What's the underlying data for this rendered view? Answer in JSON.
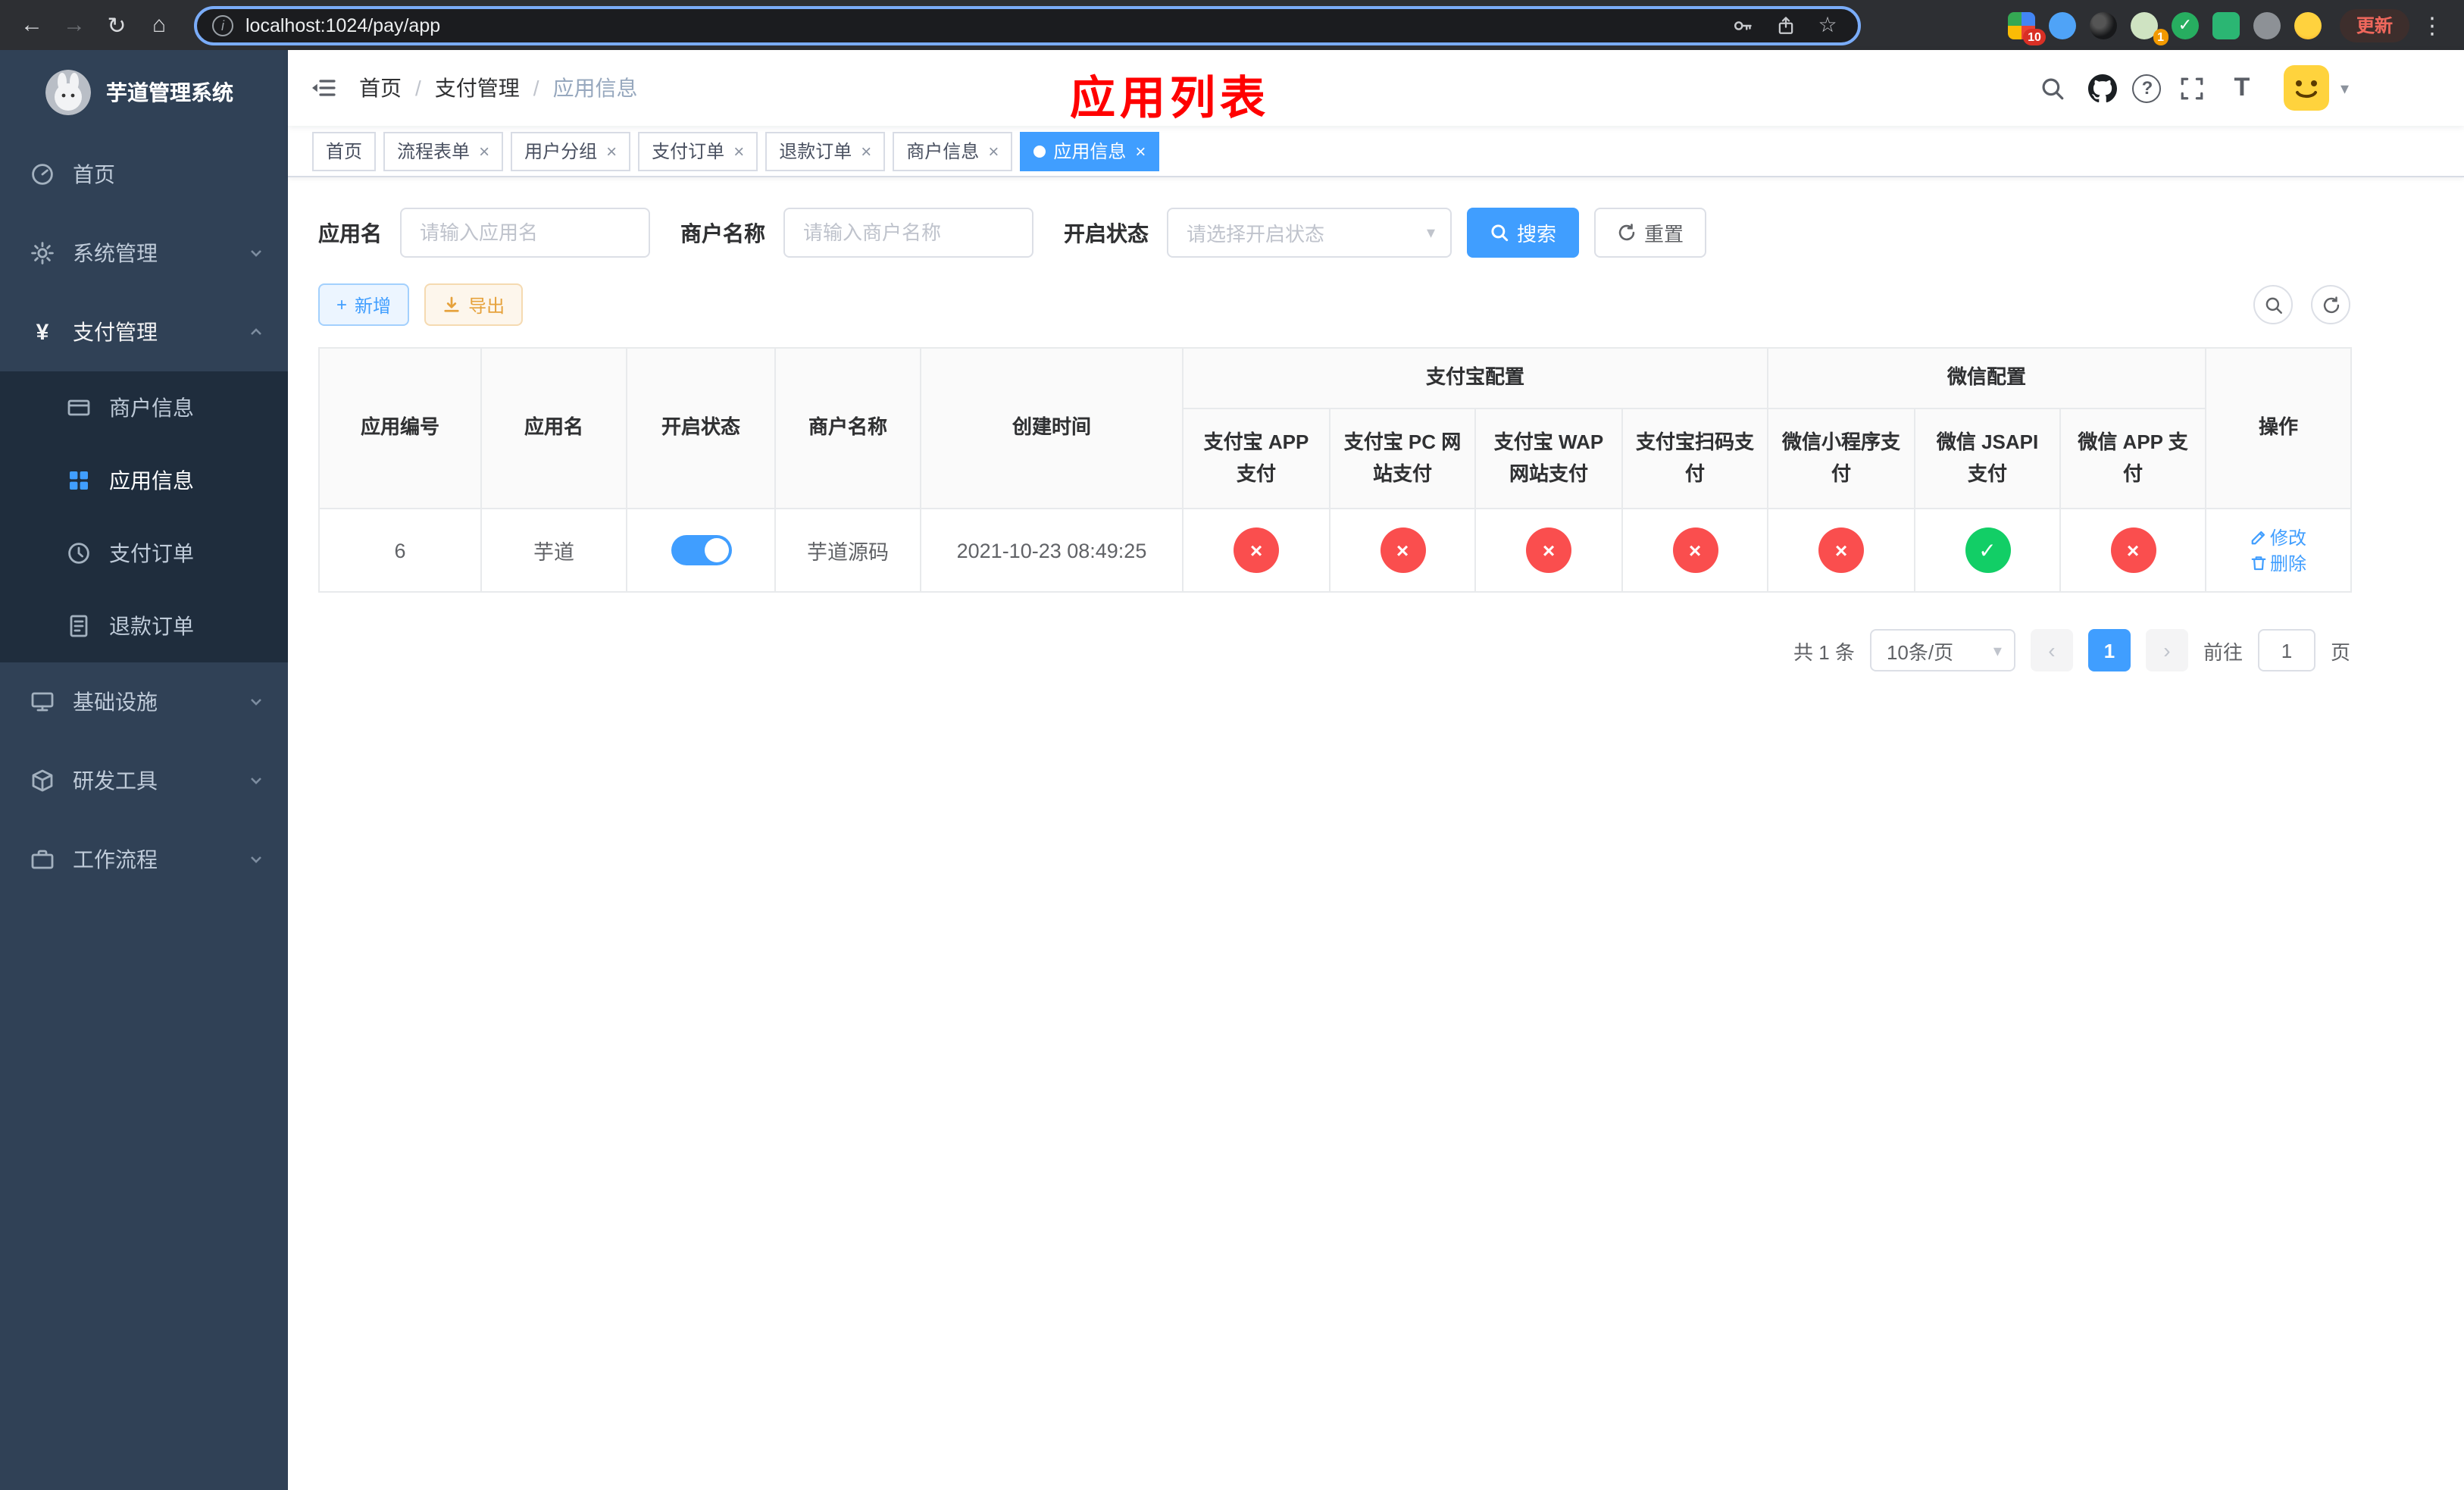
{
  "browser": {
    "url": "localhost:1024/pay/app",
    "update_button": "更新",
    "apps_badge": "10",
    "profile_badge": "1"
  },
  "sidebar": {
    "app_title": "芋道管理系统",
    "home": "首页",
    "system": "系统管理",
    "payment": "支付管理",
    "merchant_info": "商户信息",
    "app_info": "应用信息",
    "pay_order": "支付订单",
    "refund_order": "退款订单",
    "infra": "基础设施",
    "devtools": "研发工具",
    "workflow": "工作流程"
  },
  "header": {
    "breadcrumb": [
      "首页",
      "支付管理",
      "应用信息"
    ],
    "page_title": "应用列表"
  },
  "tabs": [
    {
      "label": "首页",
      "closable": false,
      "active": false
    },
    {
      "label": "流程表单",
      "closable": true,
      "active": false
    },
    {
      "label": "用户分组",
      "closable": true,
      "active": false
    },
    {
      "label": "支付订单",
      "closable": true,
      "active": false
    },
    {
      "label": "退款订单",
      "closable": true,
      "active": false
    },
    {
      "label": "商户信息",
      "closable": true,
      "active": false
    },
    {
      "label": "应用信息",
      "closable": true,
      "active": true
    }
  ],
  "filters": {
    "app_name_label": "应用名",
    "app_name_placeholder": "请输入应用名",
    "merchant_label": "商户名称",
    "merchant_placeholder": "请输入商户名称",
    "status_label": "开启状态",
    "status_placeholder": "请选择开启状态",
    "search_button": "搜索",
    "reset_button": "重置"
  },
  "toolbar": {
    "add_button": "新增",
    "export_button": "导出"
  },
  "table": {
    "group_alipay": "支付宝配置",
    "group_wechat": "微信配置",
    "columns": [
      "应用编号",
      "应用名",
      "开启状态",
      "商户名称",
      "创建时间",
      "支付宝 APP 支付",
      "支付宝 PC 网站支付",
      "支付宝 WAP 网站支付",
      "支付宝扫码支付",
      "微信小程序支付",
      "微信 JSAPI 支付",
      "微信 APP 支付",
      "操作"
    ],
    "rows": [
      {
        "id": "6",
        "name": "芋道",
        "enabled": true,
        "merchant": "芋道源码",
        "created": "2021-10-23 08:49:25",
        "statuses": [
          false,
          false,
          false,
          false,
          false,
          true,
          false
        ],
        "edit_label": "修改",
        "delete_label": "删除"
      }
    ]
  },
  "pagination": {
    "total": "共 1 条",
    "page_size": "10条/页",
    "current_page": "1",
    "goto_label": "前往",
    "goto_value": "1",
    "page_unit": "页"
  },
  "icons": {
    "check_glyph": "✓",
    "cross_glyph": "×",
    "close_glyph": "×",
    "plus_glyph": "+",
    "back_glyph": "←",
    "forward_glyph": "→",
    "reload_glyph": "↻",
    "home_glyph": "⌂",
    "star_glyph": "☆",
    "kebab_glyph": "⋮",
    "caret_glyph": "▾",
    "prev_glyph": "‹",
    "next_glyph": "›",
    "breadcrumb_separator": "/"
  },
  "colors": {
    "accent": "#409eff",
    "danger": "#fa4e4e",
    "success": "#12ce66",
    "warning": "#e6a23c",
    "title_red": "#ff0000",
    "sidebar_bg": "#304156",
    "submenu_bg": "#1f2d3d"
  }
}
